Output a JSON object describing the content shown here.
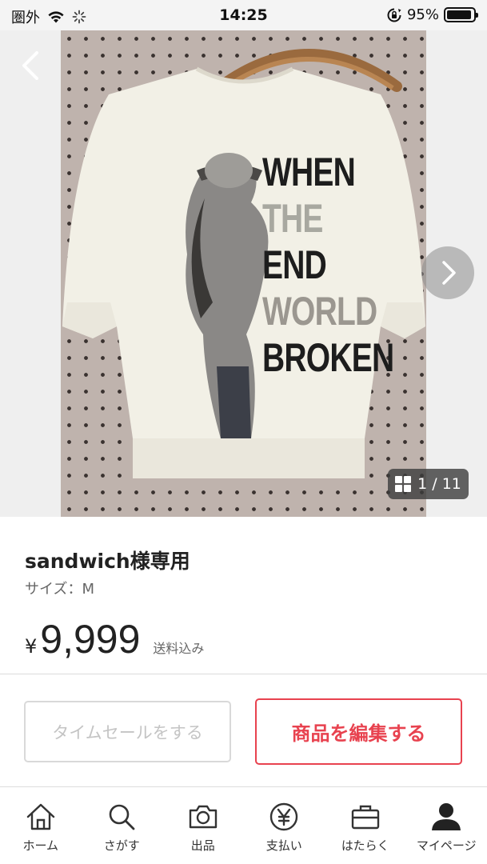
{
  "status_bar": {
    "carrier": "圏外",
    "time": "14:25",
    "battery_percent": "95%",
    "battery_level": 0.95,
    "icons": [
      "wifi-icon",
      "loading-spinner-icon",
      "rotation-lock-icon",
      "battery-icon"
    ]
  },
  "photo": {
    "counter": "1 / 11",
    "print_text": [
      "WHEN",
      "THE",
      "END",
      "WORLD",
      "BROKEN"
    ],
    "icons": [
      "back-chevron-icon",
      "next-chevron-icon",
      "grid-icon"
    ]
  },
  "item": {
    "title": "sandwich様専用",
    "size": "サイズ：M",
    "currency": "¥",
    "price": "9,999",
    "shipping_note": "送料込み"
  },
  "actions": {
    "time_sale_label": "タイムセールをする",
    "edit_label": "商品を編集する"
  },
  "tab_bar": {
    "items": [
      {
        "label": "ホーム",
        "icon": "home-icon"
      },
      {
        "label": "さがす",
        "icon": "search-icon"
      },
      {
        "label": "出品",
        "icon": "camera-icon"
      },
      {
        "label": "支払い",
        "icon": "yen-coin-icon"
      },
      {
        "label": "はたらく",
        "icon": "briefcase-icon"
      },
      {
        "label": "マイページ",
        "icon": "user-icon"
      }
    ]
  },
  "colors": {
    "accent": "#e8424f",
    "disabled_text": "#c4c4c4",
    "status_bar_bg": "#f4f4f4"
  }
}
